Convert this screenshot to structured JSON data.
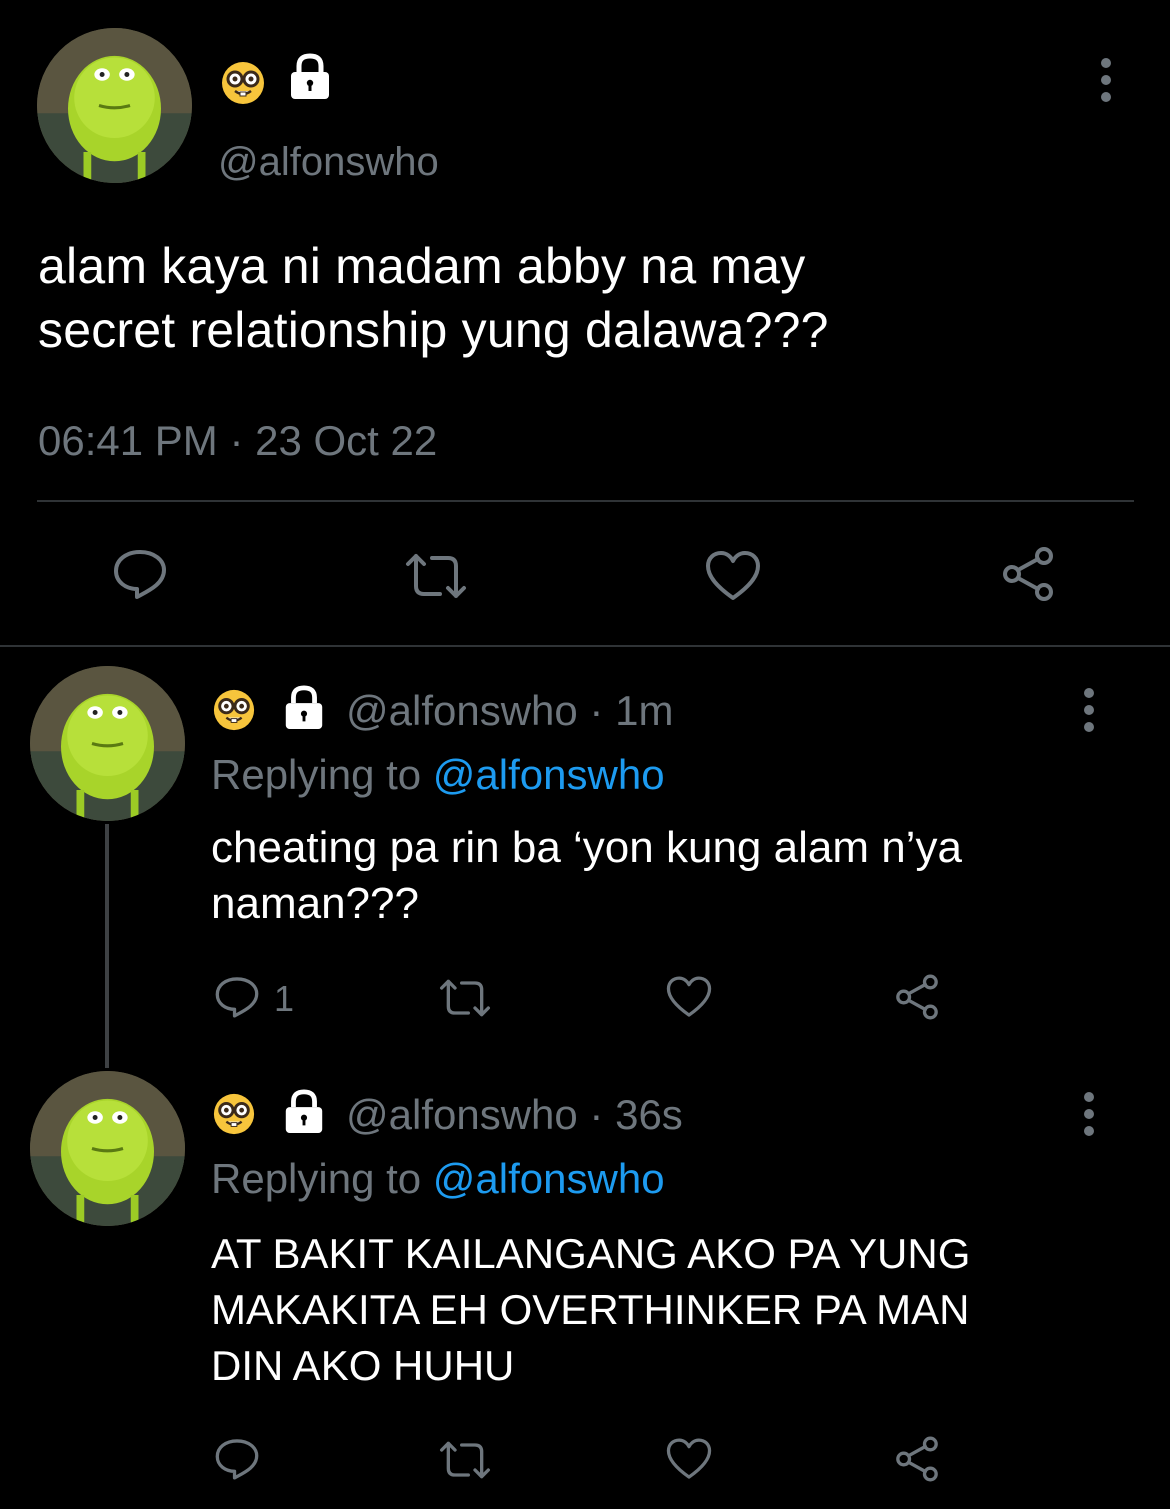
{
  "main_tweet": {
    "handle": "@alfonswho",
    "text_line1": "alam kaya ni madam abby na may",
    "text_line2": "secret relationship yung dalawa???",
    "timestamp": "06:41 PM · 23 Oct 22",
    "icons": [
      "nerd-face-emoji",
      "lock-icon",
      "more-icon",
      "reply-icon",
      "retweet-icon",
      "like-icon",
      "share-icon"
    ]
  },
  "replies": [
    {
      "handle_time": "@alfonswho · 1m",
      "replying_prefix": "Replying to",
      "replying_handle": "@alfonswho",
      "text_line1": "cheating pa rin ba ‘yon kung alam n’ya",
      "text_line2": "naman???",
      "reply_count": "1"
    },
    {
      "handle_time": "@alfonswho · 36s",
      "replying_prefix": "Replying to",
      "replying_handle": "@alfonswho",
      "text_line1": "AT BAKIT KAILANGANG AKO PA YUNG",
      "text_line2": "MAKAKITA EH OVERTHINKER PA MAN",
      "text_line3": "DIN AKO HUHU"
    }
  ],
  "colors": {
    "background": "#000000",
    "text": "#ffffff",
    "secondary": "#6e767d",
    "link": "#1d9bf0"
  }
}
